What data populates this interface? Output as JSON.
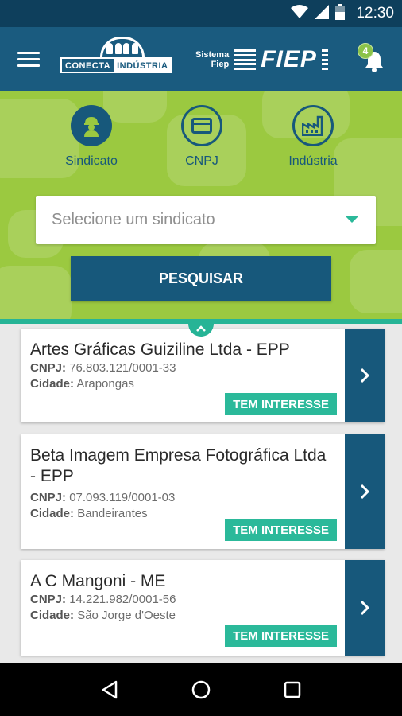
{
  "status_bar": {
    "time": "12:30"
  },
  "header": {
    "logo_conecta_part1": "CONECTA",
    "logo_conecta_part2": "INDÚSTRIA",
    "logo_sistema_line1": "Sistema",
    "logo_sistema_line2": "Fiep",
    "logo_fiep": "FIEP",
    "notification_count": "4"
  },
  "search": {
    "tabs": [
      {
        "label": "Sindicato",
        "icon": "worker-icon",
        "active": true
      },
      {
        "label": "CNPJ",
        "icon": "card-icon",
        "active": false
      },
      {
        "label": "Indústria",
        "icon": "factory-icon",
        "active": false
      }
    ],
    "select_placeholder": "Selecione um sindicato",
    "button_label": "PESQUISAR"
  },
  "results": [
    {
      "name": "Artes Gráficas Guiziline Ltda - EPP",
      "cnpj_label": "CNPJ:",
      "cnpj": "76.803.121/0001-33",
      "city_label": "Cidade:",
      "city": "Arapongas",
      "tag": "TEM INTERESSE"
    },
    {
      "name": "Beta Imagem Empresa Fotográfica Ltda - EPP",
      "cnpj_label": "CNPJ:",
      "cnpj": "07.093.119/0001-03",
      "city_label": "Cidade:",
      "city": "Bandeirantes",
      "tag": "TEM INTERESSE"
    },
    {
      "name": "A C Mangoni - ME",
      "cnpj_label": "CNPJ:",
      "cnpj": "14.221.982/0001-56",
      "city_label": "Cidade:",
      "city": "São Jorge d'Oeste",
      "tag": "TEM INTERESSE"
    }
  ],
  "colors": {
    "primary": "#17587b",
    "accent": "#2bb99a",
    "panel": "#9bc940"
  }
}
